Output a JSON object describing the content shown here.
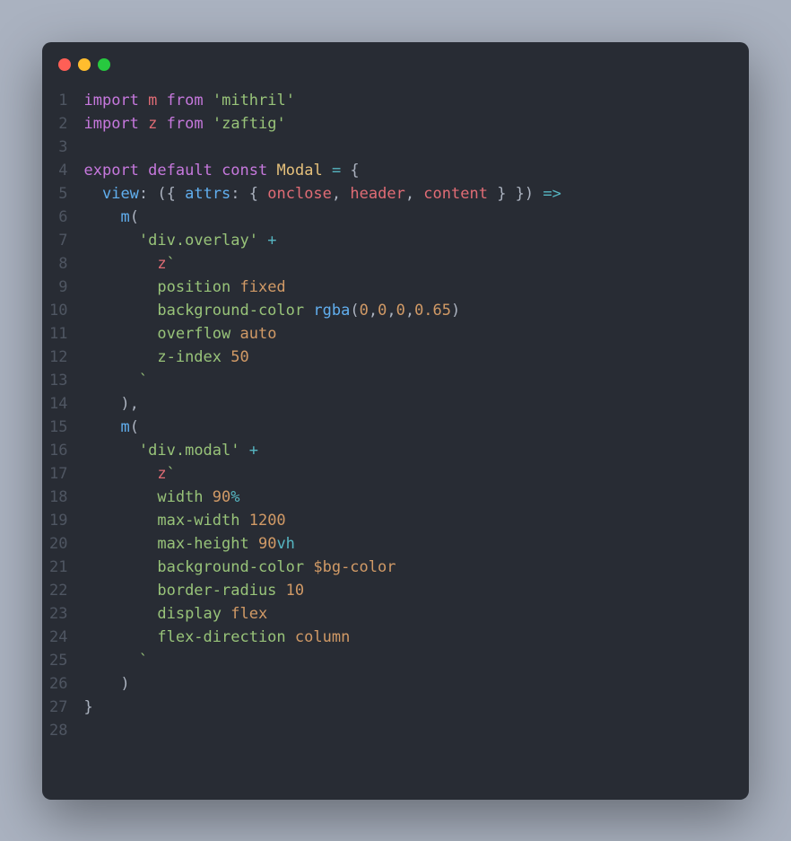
{
  "code": {
    "lines": [
      {
        "num": "1",
        "tokens": [
          [
            "kw",
            "import"
          ],
          [
            "punct",
            " "
          ],
          [
            "param",
            "m"
          ],
          [
            "punct",
            " "
          ],
          [
            "kw",
            "from"
          ],
          [
            "punct",
            " "
          ],
          [
            "str",
            "'mithril'"
          ]
        ]
      },
      {
        "num": "2",
        "tokens": [
          [
            "kw",
            "import"
          ],
          [
            "punct",
            " "
          ],
          [
            "param",
            "z"
          ],
          [
            "punct",
            " "
          ],
          [
            "kw",
            "from"
          ],
          [
            "punct",
            " "
          ],
          [
            "str",
            "'zaftig'"
          ]
        ]
      },
      {
        "num": "3",
        "tokens": []
      },
      {
        "num": "4",
        "tokens": [
          [
            "kw",
            "export"
          ],
          [
            "punct",
            " "
          ],
          [
            "kw",
            "default"
          ],
          [
            "punct",
            " "
          ],
          [
            "kw",
            "const"
          ],
          [
            "punct",
            " "
          ],
          [
            "var",
            "Modal"
          ],
          [
            "punct",
            " "
          ],
          [
            "op",
            "="
          ],
          [
            "punct",
            " {"
          ]
        ]
      },
      {
        "num": "5",
        "tokens": [
          [
            "punct",
            "  "
          ],
          [
            "fn",
            "view"
          ],
          [
            "punct",
            ": ({ "
          ],
          [
            "fn",
            "attrs"
          ],
          [
            "punct",
            ": { "
          ],
          [
            "param",
            "onclose"
          ],
          [
            "punct",
            ", "
          ],
          [
            "param",
            "header"
          ],
          [
            "punct",
            ", "
          ],
          [
            "param",
            "content"
          ],
          [
            "punct",
            " } }) "
          ],
          [
            "op",
            "=>"
          ]
        ]
      },
      {
        "num": "6",
        "tokens": [
          [
            "punct",
            "    "
          ],
          [
            "fn",
            "m"
          ],
          [
            "punct",
            "("
          ]
        ]
      },
      {
        "num": "7",
        "tokens": [
          [
            "punct",
            "      "
          ],
          [
            "str",
            "'div.overlay'"
          ],
          [
            "punct",
            " "
          ],
          [
            "op",
            "+"
          ]
        ]
      },
      {
        "num": "8",
        "tokens": [
          [
            "punct",
            "        "
          ],
          [
            "tagged",
            "z"
          ],
          [
            "tmpl",
            "`"
          ]
        ]
      },
      {
        "num": "9",
        "tokens": [
          [
            "str",
            "        position "
          ],
          [
            "val",
            "fixed"
          ]
        ]
      },
      {
        "num": "10",
        "tokens": [
          [
            "str",
            "        background-color "
          ],
          [
            "fn",
            "rgba"
          ],
          [
            "punct",
            "("
          ],
          [
            "val",
            "0"
          ],
          [
            "punct",
            ","
          ],
          [
            "val",
            "0"
          ],
          [
            "punct",
            ","
          ],
          [
            "val",
            "0"
          ],
          [
            "punct",
            ","
          ],
          [
            "val",
            "0.65"
          ],
          [
            "punct",
            ")"
          ]
        ]
      },
      {
        "num": "11",
        "tokens": [
          [
            "str",
            "        overflow "
          ],
          [
            "val",
            "auto"
          ]
        ]
      },
      {
        "num": "12",
        "tokens": [
          [
            "str",
            "        z-index "
          ],
          [
            "val",
            "50"
          ]
        ]
      },
      {
        "num": "13",
        "tokens": [
          [
            "punct",
            "      "
          ],
          [
            "tmpl",
            "`"
          ]
        ]
      },
      {
        "num": "14",
        "tokens": [
          [
            "punct",
            "    ),"
          ]
        ]
      },
      {
        "num": "15",
        "tokens": [
          [
            "punct",
            "    "
          ],
          [
            "fn",
            "m"
          ],
          [
            "punct",
            "("
          ]
        ]
      },
      {
        "num": "16",
        "tokens": [
          [
            "punct",
            "      "
          ],
          [
            "str",
            "'div.modal'"
          ],
          [
            "punct",
            " "
          ],
          [
            "op",
            "+"
          ]
        ]
      },
      {
        "num": "17",
        "tokens": [
          [
            "punct",
            "        "
          ],
          [
            "tagged",
            "z"
          ],
          [
            "tmpl",
            "`"
          ]
        ]
      },
      {
        "num": "18",
        "tokens": [
          [
            "str",
            "        width "
          ],
          [
            "val",
            "90"
          ],
          [
            "op",
            "%"
          ]
        ]
      },
      {
        "num": "19",
        "tokens": [
          [
            "str",
            "        max-width "
          ],
          [
            "val",
            "1200"
          ]
        ]
      },
      {
        "num": "20",
        "tokens": [
          [
            "str",
            "        max-height "
          ],
          [
            "val",
            "90"
          ],
          [
            "op",
            "vh"
          ]
        ]
      },
      {
        "num": "21",
        "tokens": [
          [
            "str",
            "        background-color "
          ],
          [
            "val",
            "$bg-color"
          ]
        ]
      },
      {
        "num": "22",
        "tokens": [
          [
            "str",
            "        border-radius "
          ],
          [
            "val",
            "10"
          ]
        ]
      },
      {
        "num": "23",
        "tokens": [
          [
            "str",
            "        display "
          ],
          [
            "val",
            "flex"
          ]
        ]
      },
      {
        "num": "24",
        "tokens": [
          [
            "str",
            "        flex-direction "
          ],
          [
            "val",
            "column"
          ]
        ]
      },
      {
        "num": "25",
        "tokens": [
          [
            "punct",
            "      "
          ],
          [
            "tmpl",
            "`"
          ]
        ]
      },
      {
        "num": "26",
        "tokens": [
          [
            "punct",
            "    )"
          ]
        ]
      },
      {
        "num": "27",
        "tokens": [
          [
            "punct",
            "}"
          ]
        ]
      },
      {
        "num": "28",
        "tokens": []
      }
    ]
  }
}
